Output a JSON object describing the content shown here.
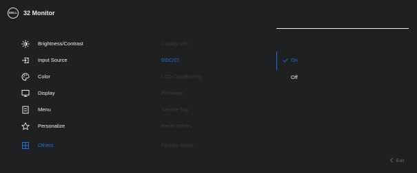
{
  "header": {
    "logo_text": "DELL",
    "title": "32 Monitor"
  },
  "menu": {
    "items": [
      {
        "label": "Brightness/Contrast",
        "icon": "sun-icon"
      },
      {
        "label": "Input Source",
        "icon": "input-arrow-icon"
      },
      {
        "label": "Color",
        "icon": "palette-icon"
      },
      {
        "label": "Display",
        "icon": "monitor-icon"
      },
      {
        "label": "Menu",
        "icon": "menu-list-icon"
      },
      {
        "label": "Personalize",
        "icon": "star-icon"
      },
      {
        "label": "Others",
        "icon": "others-grid-icon",
        "active": true
      }
    ]
  },
  "submenu": {
    "items": [
      {
        "label": "Display Info"
      },
      {
        "label": "DDC/CI",
        "active": true
      },
      {
        "label": "LCD Conditioning"
      },
      {
        "label": "Firmware"
      },
      {
        "label": "Service Tag"
      },
      {
        "label": "Reset Others"
      },
      {
        "label": "Factory Reset"
      }
    ]
  },
  "options": {
    "items": [
      {
        "label": "On",
        "selected": true
      },
      {
        "label": "Off",
        "selected": false
      }
    ]
  },
  "footer": {
    "exit_label": "Exit"
  },
  "colors": {
    "accent": "#1f73d6",
    "background": "#1f2022",
    "text": "#f0f1f3",
    "dim_text": "#3a3c3f"
  }
}
